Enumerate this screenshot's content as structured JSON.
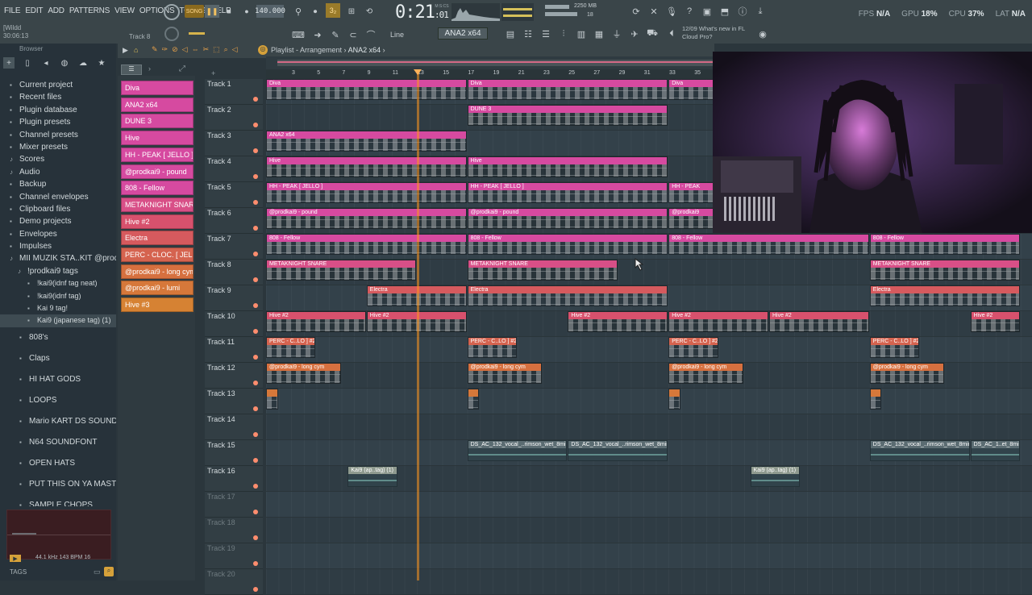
{
  "menu": [
    "FILE",
    "EDIT",
    "ADD",
    "PATTERNS",
    "VIEW",
    "OPTIONS",
    "TOOLS",
    "HELP"
  ],
  "transport": {
    "song_label": "SONG",
    "tempo": "140.000",
    "time": "0:21",
    "time_sub": ":01",
    "time_unit": "M:S:CS",
    "cpu_mem": "2250 MB",
    "voices": "58",
    "mem2": "18"
  },
  "hint": {
    "line1": "[Wildd",
    "line2": "30:06:13",
    "track_label": "Track 8"
  },
  "toolbar2": {
    "snap": "Line",
    "pattern": "ANA2 x64"
  },
  "news": {
    "date": "12/09",
    "line1": "What's new in FL",
    "line2": "Cloud Pro?"
  },
  "stats": {
    "fps_label": "FPS",
    "fps": "N/A",
    "gpu_label": "GPU",
    "gpu": "18%",
    "cpu_label": "CPU",
    "cpu": "37%",
    "lat_label": "LAT",
    "lat": "N/A"
  },
  "browser": {
    "title": "Browser",
    "items": [
      {
        "label": "Current project",
        "level": 0,
        "icon": "folder"
      },
      {
        "label": "Recent files",
        "level": 0,
        "icon": "folder"
      },
      {
        "label": "Plugin database",
        "level": 0,
        "icon": "folder"
      },
      {
        "label": "Plugin presets",
        "level": 0,
        "icon": "folder"
      },
      {
        "label": "Channel presets",
        "level": 0,
        "icon": "folder"
      },
      {
        "label": "Mixer presets",
        "level": 0,
        "icon": "folder"
      },
      {
        "label": "Scores",
        "level": 0,
        "icon": "note"
      },
      {
        "label": "Audio",
        "level": 0,
        "icon": "note"
      },
      {
        "label": "Backup",
        "level": 0,
        "icon": "folder"
      },
      {
        "label": "Channel envelopes",
        "level": 0,
        "icon": "folder"
      },
      {
        "label": "Clipboard files",
        "level": 0,
        "icon": "folder"
      },
      {
        "label": "Demo projects",
        "level": 0,
        "icon": "folder"
      },
      {
        "label": "Envelopes",
        "level": 0,
        "icon": "folder"
      },
      {
        "label": "Impulses",
        "level": 0,
        "icon": "folder"
      },
      {
        "label": "MII MUZIK STA..KIT @prodkai9",
        "level": 0,
        "icon": "note"
      },
      {
        "label": "!prodkai9 tags",
        "level": 1,
        "icon": "note"
      },
      {
        "label": "!kai9(idnf tag neat)",
        "level": 2,
        "icon": "file"
      },
      {
        "label": "!kai9(idnf tag)",
        "level": 2,
        "icon": "file"
      },
      {
        "label": "Kai 9 tag!",
        "level": 2,
        "icon": "file"
      },
      {
        "label": "Kai9 (japanese tag) (1)",
        "level": 2,
        "icon": "file",
        "selected": true
      },
      {
        "label": "808's",
        "level": 1,
        "icon": "folder",
        "big": true
      },
      {
        "label": "Claps",
        "level": 1,
        "icon": "folder",
        "big": true
      },
      {
        "label": "HI HAT GODS",
        "level": 1,
        "icon": "folder",
        "big": true
      },
      {
        "label": "LOOPS",
        "level": 1,
        "icon": "folder",
        "big": true
      },
      {
        "label": "Mario KART DS SOUNDFONT",
        "level": 1,
        "icon": "folder",
        "big": true
      },
      {
        "label": "N64 SOUNDFONT",
        "level": 1,
        "icon": "folder",
        "big": true
      },
      {
        "label": "OPEN HATS",
        "level": 1,
        "icon": "folder",
        "big": true
      },
      {
        "label": "PUT THIS ON YA MASTER",
        "level": 1,
        "icon": "folder",
        "big": true
      },
      {
        "label": "SAMPLE CHOPS",
        "level": 1,
        "icon": "folder",
        "big": true
      }
    ],
    "sample_info": "44.1 kHz 143 BPM 16",
    "tags_label": "TAGS"
  },
  "patterns": [
    {
      "label": "Diva",
      "color": "#d64aa0"
    },
    {
      "label": "ANA2 x64",
      "color": "#d64aa0"
    },
    {
      "label": "DUNE 3",
      "color": "#d64aa0"
    },
    {
      "label": "Hive",
      "color": "#d64aa0"
    },
    {
      "label": "HH - PEAK [ JELLO ]",
      "color": "#d64aa0"
    },
    {
      "label": "@prodkai9 - pound",
      "color": "#d64aa0"
    },
    {
      "label": "808 - Fellow",
      "color": "#d64aa0"
    },
    {
      "label": "METAKNIGHT SNARE",
      "color": "#d84f87"
    },
    {
      "label": "Hive #2",
      "color": "#d8516d"
    },
    {
      "label": "Electra",
      "color": "#d65a5e"
    },
    {
      "label": "PERC - CLOC. [ JELLO ] #2",
      "color": "#d5634f"
    },
    {
      "label": "@prodkai9 - long cym",
      "color": "#d6703f"
    },
    {
      "label": "@prodkai9 - lumi",
      "color": "#d6783a"
    },
    {
      "label": "Hive #3",
      "color": "#d68233"
    }
  ],
  "playlist": {
    "title": "Playlist - Arrangement",
    "pattern": "ANA2 x64"
  },
  "ruler": [
    "3",
    "5",
    "7",
    "9",
    "11",
    "13",
    "15",
    "17",
    "19",
    "21",
    "23",
    "25",
    "27",
    "29",
    "31",
    "33",
    "35"
  ],
  "tracks": [
    {
      "name": "Track 1",
      "clips": [
        {
          "label": "Diva",
          "start": 0,
          "end": 16,
          "color": "#d64aa0"
        },
        {
          "label": "Diva",
          "start": 16,
          "end": 32,
          "color": "#d64aa0"
        },
        {
          "label": "Diva",
          "start": 32,
          "end": 36,
          "color": "#d64aa0"
        }
      ]
    },
    {
      "name": "Track 2",
      "clips": [
        {
          "label": "DUNE 3",
          "start": 16,
          "end": 32,
          "color": "#d64aa0"
        }
      ]
    },
    {
      "name": "Track 3",
      "clips": [
        {
          "label": "ANA2 x64",
          "start": 0,
          "end": 16,
          "color": "#d64aa0"
        }
      ]
    },
    {
      "name": "Track 4",
      "clips": [
        {
          "label": "Hive",
          "start": 0,
          "end": 16,
          "color": "#d64aa0"
        },
        {
          "label": "Hive",
          "start": 16,
          "end": 32,
          "color": "#d64aa0"
        }
      ]
    },
    {
      "name": "Track 5",
      "clips": [
        {
          "label": "HH - PEAK [ JELLO ]",
          "start": 0,
          "end": 16,
          "color": "#d64aa0"
        },
        {
          "label": "HH - PEAK [ JELLO ]",
          "start": 16,
          "end": 32,
          "color": "#d64aa0"
        },
        {
          "label": "HH - PEAK",
          "start": 32,
          "end": 36,
          "color": "#d64aa0"
        }
      ]
    },
    {
      "name": "Track 6",
      "clips": [
        {
          "label": "@prodkai9 - pound",
          "start": 0,
          "end": 16,
          "color": "#d64aa0"
        },
        {
          "label": "@prodkai9 - pound",
          "start": 16,
          "end": 32,
          "color": "#d64aa0"
        },
        {
          "label": "@prodkai9",
          "start": 32,
          "end": 36,
          "color": "#d64aa0"
        }
      ]
    },
    {
      "name": "Track 7",
      "clips": [
        {
          "label": "808 - Fellow",
          "start": 0,
          "end": 16,
          "color": "#d64aa0"
        },
        {
          "label": "808 - Fellow",
          "start": 16,
          "end": 32,
          "color": "#d64aa0"
        },
        {
          "label": "808 - Fellow",
          "start": 32,
          "end": 48,
          "color": "#d64aa0"
        },
        {
          "label": "808 - Fellow",
          "start": 48,
          "end": 60,
          "color": "#d64aa0"
        }
      ]
    },
    {
      "name": "Track 8",
      "clips": [
        {
          "label": "METAKNIGHT SNARE",
          "start": 0,
          "end": 12,
          "color": "#d84f87"
        },
        {
          "label": "METAKNIGHT SNARE",
          "start": 16,
          "end": 28,
          "color": "#d84f87"
        },
        {
          "label": "METAKNIGHT SNARE",
          "start": 48,
          "end": 60,
          "color": "#d84f87"
        }
      ]
    },
    {
      "name": "Track 9",
      "clips": [
        {
          "label": "Electra",
          "start": 8,
          "end": 16,
          "color": "#d65a5e"
        },
        {
          "label": "Electra",
          "start": 16,
          "end": 32,
          "color": "#d65a5e"
        },
        {
          "label": "Electra",
          "start": 48,
          "end": 60,
          "color": "#d65a5e"
        }
      ]
    },
    {
      "name": "Track 10",
      "clips": [
        {
          "label": "Hive #2",
          "start": 0,
          "end": 8,
          "color": "#d8516d"
        },
        {
          "label": "Hive #2",
          "start": 8,
          "end": 16,
          "color": "#d8516d"
        },
        {
          "label": "Hive #2",
          "start": 24,
          "end": 32,
          "color": "#d8516d"
        },
        {
          "label": "Hive #2",
          "start": 32,
          "end": 40,
          "color": "#d8516d"
        },
        {
          "label": "Hive #2",
          "start": 40,
          "end": 48,
          "color": "#d8516d"
        },
        {
          "label": "Hive #2",
          "start": 56,
          "end": 60,
          "color": "#d8516d"
        }
      ]
    },
    {
      "name": "Track 11",
      "clips": [
        {
          "label": "PERC - C..LO ] #2",
          "start": 0,
          "end": 4,
          "color": "#d5634f"
        },
        {
          "label": "PERC - C..LO ] #2",
          "start": 16,
          "end": 20,
          "color": "#d5634f"
        },
        {
          "label": "PERC - C..LO ] #2",
          "start": 32,
          "end": 36,
          "color": "#d5634f"
        },
        {
          "label": "PERC - C..LO ] #2",
          "start": 48,
          "end": 52,
          "color": "#d5634f"
        }
      ]
    },
    {
      "name": "Track 12",
      "clips": [
        {
          "label": "@prodkai9 - long cym",
          "start": 0,
          "end": 6,
          "color": "#d6703f"
        },
        {
          "label": "@prodkai9 - long cym",
          "start": 16,
          "end": 22,
          "color": "#d6703f"
        },
        {
          "label": "@prodkai9 - long cym",
          "start": 32,
          "end": 38,
          "color": "#d6703f"
        },
        {
          "label": "@prodkai9 - long cym",
          "start": 48,
          "end": 54,
          "color": "#d6703f"
        }
      ]
    },
    {
      "name": "Track 13",
      "clips": [
        {
          "label": "",
          "start": 0,
          "end": 1,
          "color": "#d6783a"
        },
        {
          "label": "",
          "start": 16,
          "end": 17,
          "color": "#d6783a"
        },
        {
          "label": "",
          "start": 32,
          "end": 33,
          "color": "#d6783a"
        },
        {
          "label": "",
          "start": 48,
          "end": 49,
          "color": "#d6783a"
        }
      ]
    },
    {
      "name": "Track 14",
      "clips": []
    },
    {
      "name": "Track 15",
      "clips": [
        {
          "label": "DS_AC_132_vocal_..rimson_wet_8min",
          "start": 16,
          "end": 24,
          "color": "#5b6c72",
          "audio": true
        },
        {
          "label": "DS_AC_132_vocal_..rimson_wet_8min",
          "start": 24,
          "end": 32,
          "color": "#5b6c72",
          "audio": true
        },
        {
          "label": "DS_AC_132_vocal_..rimson_wet_8min",
          "start": 48,
          "end": 56,
          "color": "#5b6c72",
          "audio": true
        },
        {
          "label": "DS_AC_1..et_8min",
          "start": 56,
          "end": 60,
          "color": "#5b6c72",
          "audio": true
        }
      ]
    },
    {
      "name": "Track 16",
      "clips": [
        {
          "label": "Kai9 (ap..tag) (1)",
          "start": 6.5,
          "end": 10.5,
          "color": "#8f9a8f",
          "audio": true
        },
        {
          "label": "Kai9 (ap..tag) (1)",
          "start": 38.5,
          "end": 42.5,
          "color": "#8f9a8f",
          "audio": true
        }
      ]
    },
    {
      "name": "Track 17",
      "clips": [],
      "dim": true
    },
    {
      "name": "Track 18",
      "clips": [],
      "dim": true
    },
    {
      "name": "Track 19",
      "clips": [],
      "dim": true
    },
    {
      "name": "Track 20",
      "clips": [],
      "dim": true
    }
  ],
  "webcam": {
    "description_icon": "webcam-overlay"
  }
}
